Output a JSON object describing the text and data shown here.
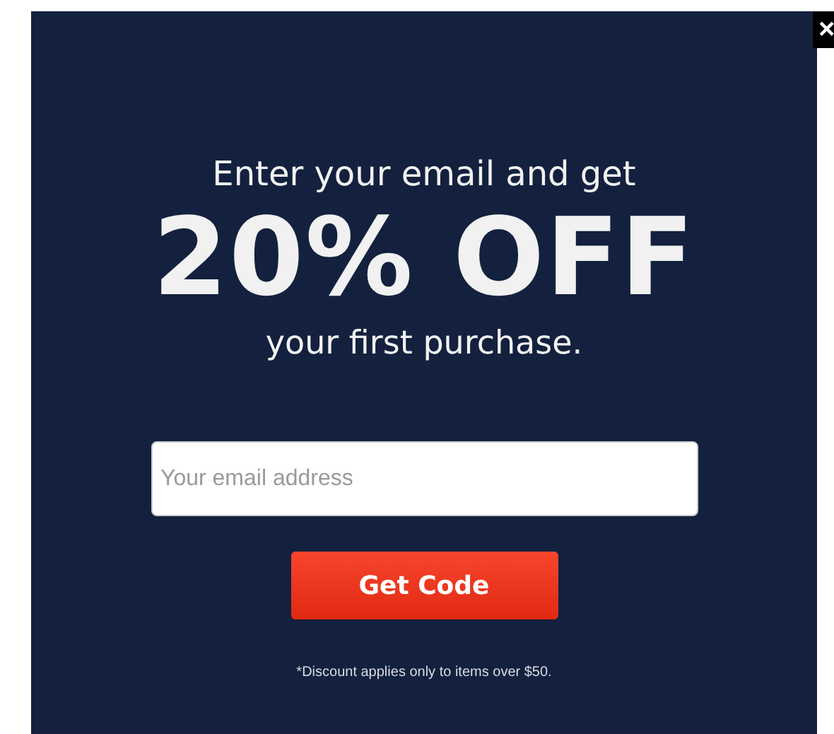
{
  "close_button": {
    "label": "×"
  },
  "headline": "Enter your email and get",
  "offer": "20% OFF",
  "subline": "your first purchase.",
  "email_field": {
    "placeholder": "Your email address"
  },
  "submit_button": {
    "label": "Get Code"
  },
  "footnote": "*Discount applies only to items over $50."
}
